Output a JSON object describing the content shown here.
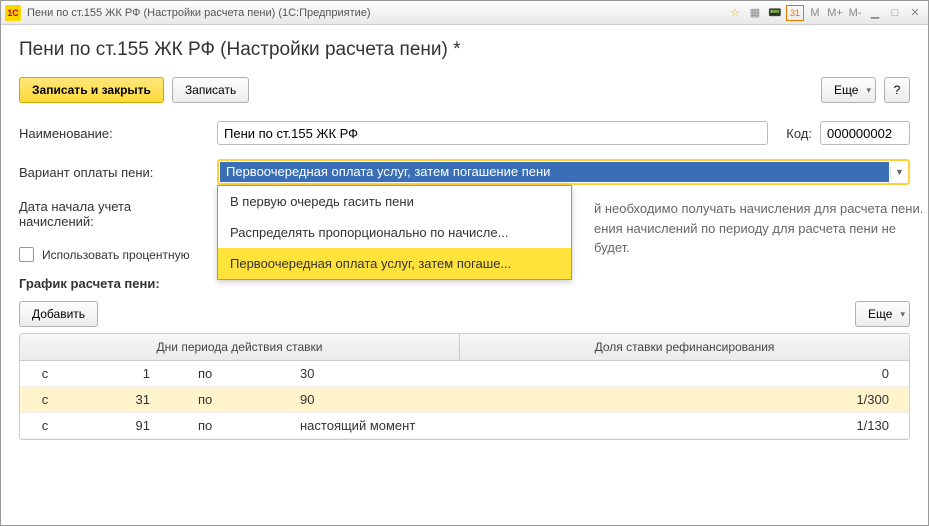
{
  "window": {
    "title": "Пени по ст.155 ЖК РФ (Настройки расчета пени)  (1С:Предприятие)"
  },
  "page": {
    "title": "Пени по ст.155 ЖК РФ (Настройки расчета пени) *"
  },
  "toolbar": {
    "save_close": "Записать и закрыть",
    "save": "Записать",
    "more": "Еще",
    "help": "?"
  },
  "fields": {
    "name_label": "Наименование:",
    "name_value": "Пени по ст.155 ЖК РФ",
    "code_label": "Код:",
    "code_value": "000000002",
    "variant_label": "Вариант оплаты пени:",
    "variant_selected": "Первоочередная оплата услуг, затем погашение пени",
    "date_label": "Дата начала учета начислений:",
    "checkbox_label": "Использовать процентную",
    "schedule_label": "График расчета пени:",
    "add_btn": "Добавить"
  },
  "dropdown": {
    "options": [
      "В первую очередь гасить пени",
      "Распределять пропорционально по начисле...",
      "Первоочередная оплата услуг, затем погаше..."
    ],
    "active_index": 2
  },
  "hint": {
    "line1": "й необходимо получать начисления для расчета пени.",
    "line2": "ения начислений по периоду для расчета пени не будет."
  },
  "table": {
    "header1": "Дни периода действия ставки",
    "header2": "Доля ставки рефинансирования",
    "col_from": "с",
    "col_to": "по",
    "rows": [
      {
        "from": "1",
        "to": "30",
        "share": "0"
      },
      {
        "from": "31",
        "to": "90",
        "share": "1/300"
      },
      {
        "from": "91",
        "to": "настоящий момент",
        "share": "1/130"
      }
    ],
    "selected_row": 1
  }
}
